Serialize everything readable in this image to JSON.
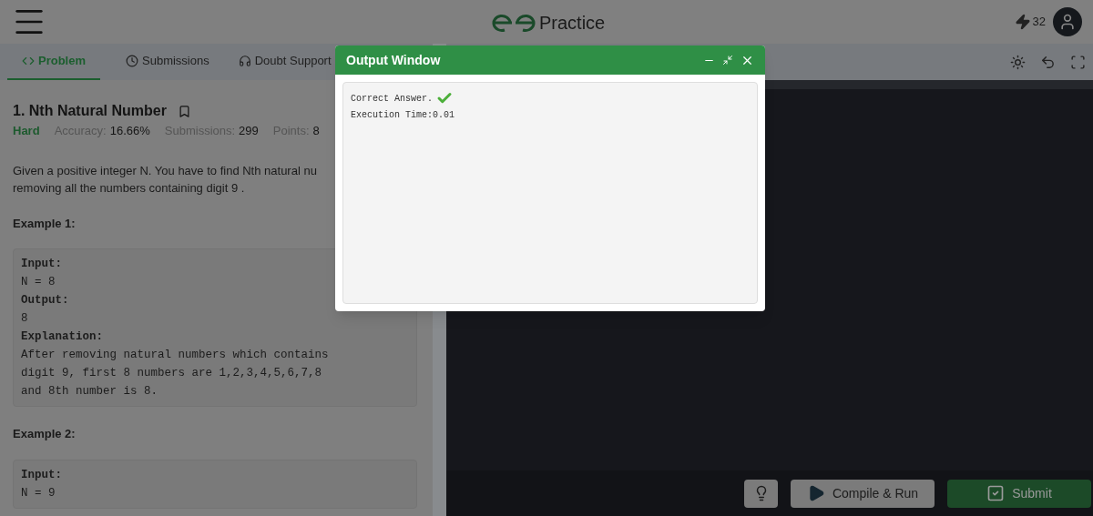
{
  "header": {
    "logo_text": "Practice",
    "streak_count": "32"
  },
  "tabs": [
    {
      "label": "Problem",
      "selected": true
    },
    {
      "label": "Submissions",
      "selected": false
    },
    {
      "label": "Doubt Support",
      "selected": false
    }
  ],
  "problem": {
    "title": "1. Nth Natural Number",
    "difficulty": "Hard",
    "stats": [
      {
        "label": "Accuracy:",
        "value": "16.66%"
      },
      {
        "label": "Submissions:",
        "value": "299"
      },
      {
        "label": "Points:",
        "value": "8"
      }
    ],
    "description": [
      "Given a positive integer N. You have to find Nth natural nu",
      "removing all the numbers containing digit 9 ."
    ],
    "examples": [
      {
        "heading": "Example 1:",
        "lines": [
          {
            "text": "Input:",
            "kind": "label"
          },
          {
            "text": "N = 8",
            "kind": "value"
          },
          {
            "text": "Output:",
            "kind": "label"
          },
          {
            "text": "8",
            "kind": "value"
          },
          {
            "text": "Explanation:",
            "kind": "label"
          },
          {
            "text": "After removing natural numbers which contains",
            "kind": "value"
          },
          {
            "text": "digit 9, first 8 numbers are 1,2,3,4,5,6,7,8",
            "kind": "value"
          },
          {
            "text": "and 8th number is 8.",
            "kind": "value"
          }
        ]
      },
      {
        "heading": "Example 2:",
        "lines": [
          {
            "text": "Input:",
            "kind": "label"
          },
          {
            "text": "N = 9",
            "kind": "value"
          }
        ]
      }
    ]
  },
  "output_window": {
    "title": "Output Window",
    "lines": [
      {
        "text": "Correct Answer.",
        "kind": "status"
      },
      {
        "text": "Execution Time:0.01",
        "kind": "plain"
      }
    ]
  },
  "footer_buttons": [
    {
      "label": "Compile & Run",
      "kind": "run"
    },
    {
      "label": "Submit",
      "kind": "submit"
    }
  ]
}
